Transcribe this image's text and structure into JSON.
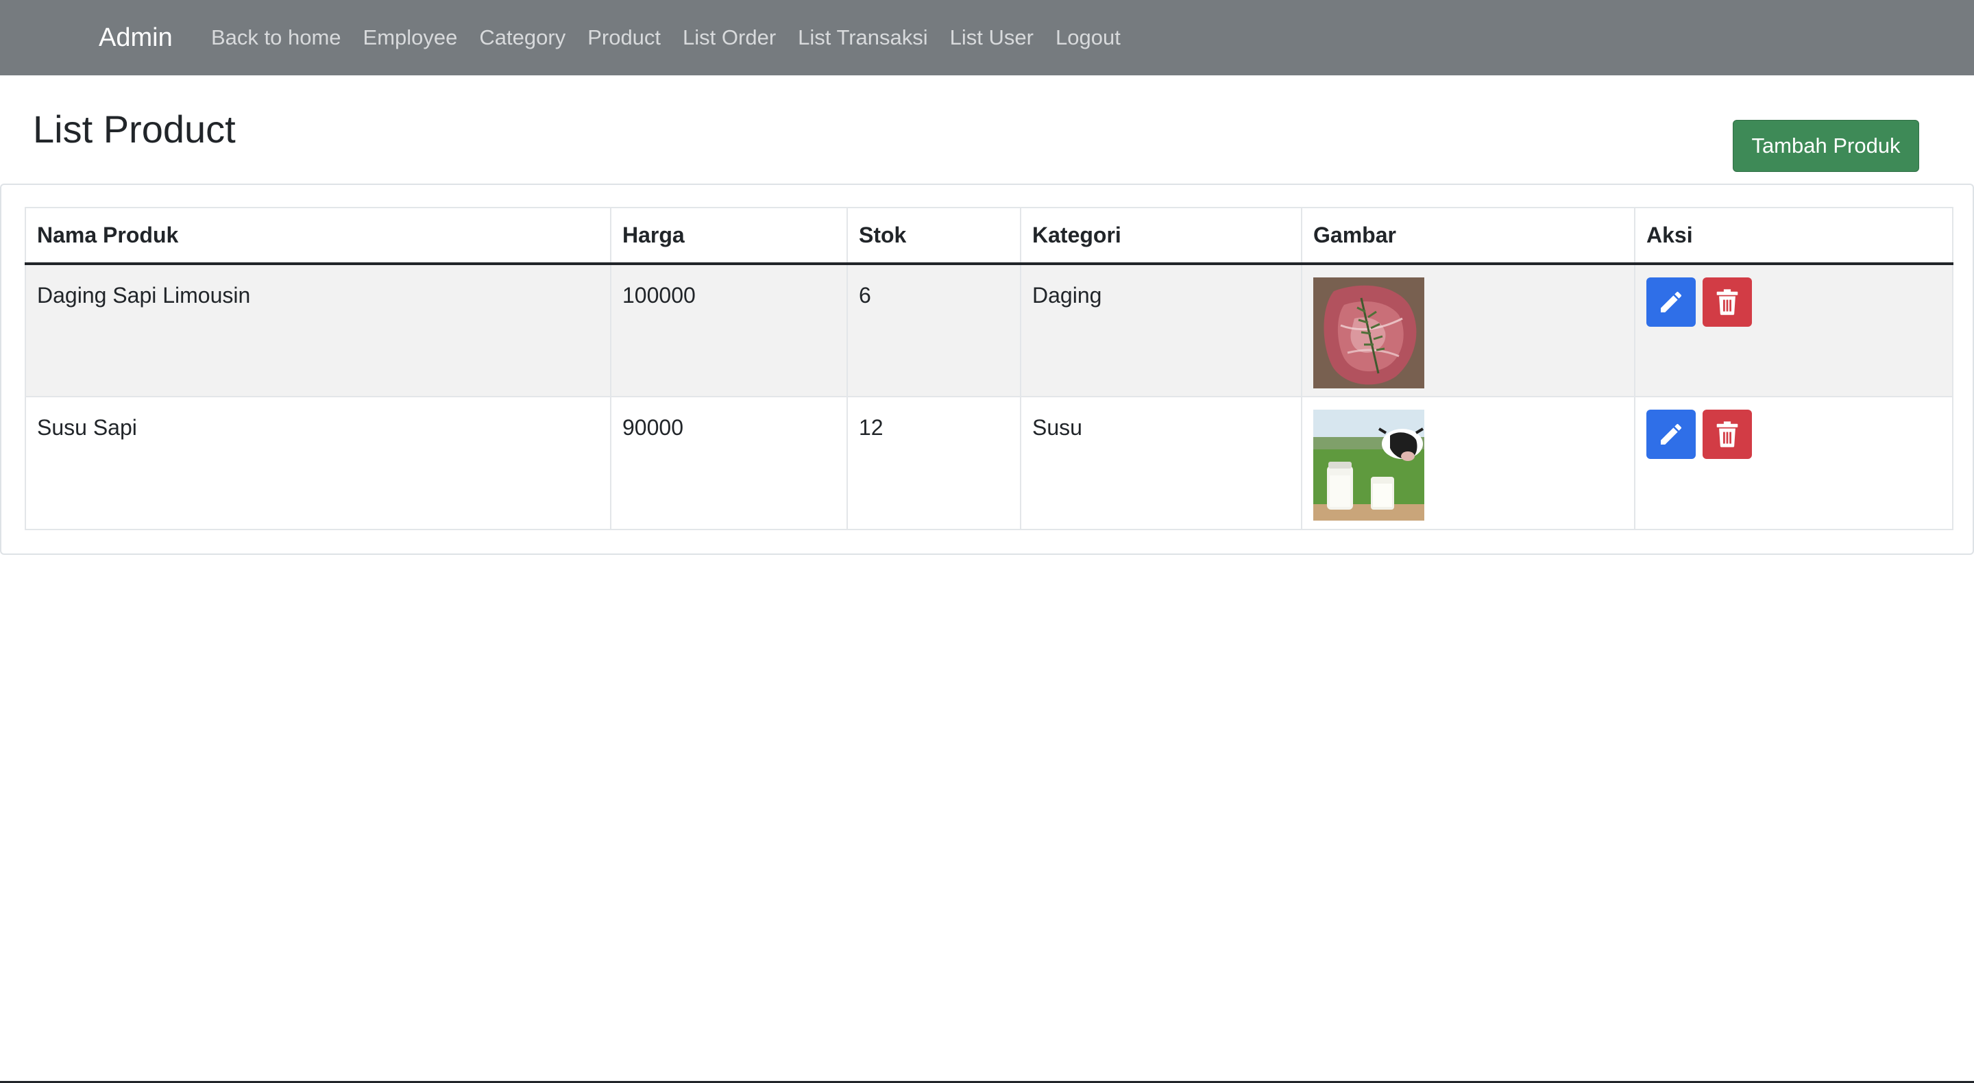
{
  "navbar": {
    "brand": "Admin",
    "links": [
      "Back to home",
      "Employee",
      "Category",
      "Product",
      "List Order",
      "List Transaksi",
      "List User",
      "Logout"
    ]
  },
  "page": {
    "title": "List Product",
    "add_button": "Tambah Produk"
  },
  "table": {
    "headers": [
      "Nama Produk",
      "Harga",
      "Stok",
      "Kategori",
      "Gambar",
      "Aksi"
    ],
    "rows": [
      {
        "name": "Daging Sapi Limousin",
        "price": "100000",
        "stock": "6",
        "category": "Daging",
        "image": "beef-steak-image"
      },
      {
        "name": "Susu Sapi",
        "price": "90000",
        "stock": "12",
        "category": "Susu",
        "image": "milk-cow-image"
      }
    ]
  },
  "colors": {
    "navbar_bg": "#767b7f",
    "add_button": "#3e8a57",
    "edit_button": "#2f6fe8",
    "delete_button": "#d23c45"
  },
  "icons": {
    "edit": "pencil-icon",
    "delete": "trash-icon"
  }
}
